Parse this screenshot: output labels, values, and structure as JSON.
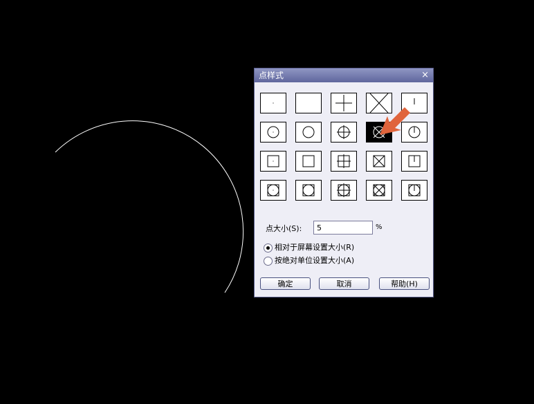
{
  "dialog": {
    "title": "点样式",
    "close_glyph": "×",
    "styles": [
      [
        "dot",
        "none",
        "plus",
        "cross",
        "tick"
      ],
      [
        "circle-dot",
        "circle",
        "circle-plus",
        "circle-cross",
        "circle-tick"
      ],
      [
        "square-dot",
        "square",
        "square-plus",
        "square-cross",
        "square-tick"
      ],
      [
        "circle-square-dot",
        "circle-square",
        "circle-square-plus",
        "circle-square-cross",
        "circle-square-tick"
      ]
    ],
    "selected_style": "circle-cross",
    "size_label": "点大小(S):",
    "size_value": "5",
    "size_unit": "%",
    "options": [
      {
        "label": "相对于屏幕设置大小(R)",
        "checked": true
      },
      {
        "label": "按绝对单位设置大小(A)",
        "checked": false
      }
    ],
    "buttons": {
      "ok": "确定",
      "cancel": "取消",
      "help": "帮助(H)"
    }
  },
  "colors": {
    "arrow": "#e0643c",
    "arc": "#ffffff",
    "background": "#000000"
  }
}
